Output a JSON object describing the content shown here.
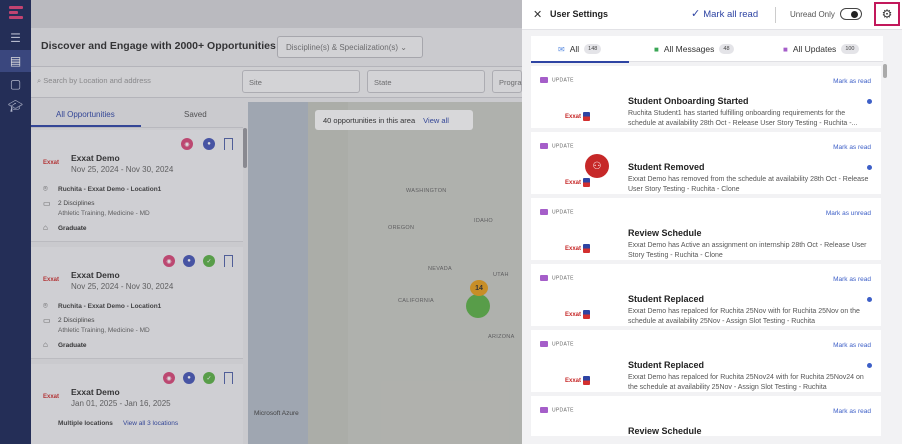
{
  "page": {
    "heading": "Discover and Engage with 2000+ Opportunities",
    "discipline_select": "Discipline(s) & Specialization(s)",
    "search_placeholder": "Search by Location and address",
    "filters": [
      "Site",
      "State",
      "Progra"
    ],
    "tabs": [
      "All Opportunities",
      "Saved"
    ],
    "cards": [
      {
        "logo": "Exxat",
        "name": "Exxat Demo",
        "dates": "Nov 25, 2024 - Nov 30, 2024",
        "location": "Ruchita - Exxat Demo - Location1",
        "disciplines": "2 Disciplines",
        "disciplines_detail": "Athletic Training, Medicine - MD",
        "level": "Graduate"
      },
      {
        "logo": "Exxat",
        "name": "Exxat Demo",
        "dates": "Nov 25, 2024 - Nov 30, 2024",
        "location": "Ruchita - Exxat Demo - Location1",
        "disciplines": "2 Disciplines",
        "disciplines_detail": "Athletic Training, Medicine - MD",
        "level": "Graduate"
      },
      {
        "logo": "Exxat",
        "name": "Exxat Demo",
        "dates": "Jan 01, 2025 - Jan 16, 2025",
        "location": "Multiple locations",
        "view_all": "View all 3 locations"
      }
    ],
    "map": {
      "chip_text": "40 opportunities in this area",
      "chip_link": "View all",
      "cluster": "14",
      "labels": [
        "WASHINGTON",
        "OREGON",
        "IDAHO",
        "NEVADA",
        "UTAH",
        "CALIFORNIA",
        "ARIZONA"
      ],
      "credit": "Microsoft Azure"
    }
  },
  "drawer": {
    "title": "User Settings",
    "mark_all_read": "Mark all read",
    "unread_only": "Unread Only",
    "tabs": [
      {
        "label": "All",
        "count": "148"
      },
      {
        "label": "All Messages",
        "count": "48"
      },
      {
        "label": "All Updates",
        "count": "100"
      }
    ],
    "items": [
      {
        "tag": "UPDATE",
        "action": "Mark as read",
        "logo": "Exxat",
        "title": "Student Onboarding Started",
        "desc": "Ruchita Student1 has started fulfilling onboarding requirements for the schedule at availability 28th Oct - Release User Story Testing - Ruchita -...",
        "unread": true
      },
      {
        "tag": "UPDATE",
        "action": "Mark as read",
        "logo": "Exxat",
        "title": "Student Removed",
        "desc": "Exxat Demo has removed from the schedule at availability 28th Oct - Release User Story Testing - Ruchita - Clone",
        "unread": true
      },
      {
        "tag": "UPDATE",
        "action": "Mark as unread",
        "logo": "Exxat",
        "title": "Review Schedule",
        "desc": "Exxat Demo has Active an assignment on internship 28th Oct - Release User Story Testing - Ruchita - Clone",
        "unread": false
      },
      {
        "tag": "UPDATE",
        "action": "Mark as read",
        "logo": "Exxat",
        "title": "Student Replaced",
        "desc": "Exxat Demo has repalced for Ruchita 25Nov with for Ruchita 25Nov on the schedule at availability 25Nov - Assign Slot Testing - Ruchita",
        "unread": true
      },
      {
        "tag": "UPDATE",
        "action": "Mark as read",
        "logo": "Exxat",
        "title": "Student Replaced",
        "desc": "Exxat Demo has repalced for Ruchita 25Nov24 with for Ruchita 25Nov24 on the schedule at availability 25Nov - Assign Slot Testing - Ruchita",
        "unread": true
      },
      {
        "tag": "UPDATE",
        "action": "Mark as read",
        "logo": "Exxat",
        "title": "Review Schedule",
        "desc": "",
        "unread": false
      }
    ]
  },
  "colors": {
    "brand_navy": "#1f2b5b",
    "accent_blue": "#2e44a3",
    "highlight_pink": "#c2185b",
    "unread_dot": "#3d5fc7"
  }
}
